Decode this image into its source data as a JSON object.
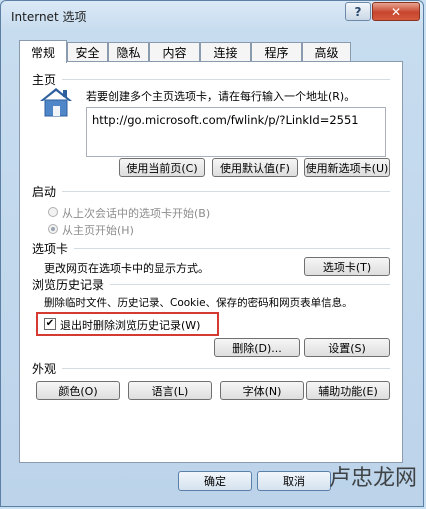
{
  "window": {
    "title": "Internet 选项",
    "help": "?",
    "close": "✕"
  },
  "tabs": [
    {
      "label": "常规",
      "active": true
    },
    {
      "label": "安全"
    },
    {
      "label": "隐私"
    },
    {
      "label": "内容"
    },
    {
      "label": "连接"
    },
    {
      "label": "程序"
    },
    {
      "label": "高级"
    }
  ],
  "home": {
    "title": "主页",
    "icon": "home-icon",
    "description": "若要创建多个主页选项卡，请在每行输入一个地址(R)。",
    "url": "http://go.microsoft.com/fwlink/p/?LinkId=2551",
    "buttons": {
      "current": "使用当前页(C)",
      "default": "使用默认值(F)",
      "new_tab": "使用新选项卡(U)"
    }
  },
  "startup": {
    "title": "启动",
    "options": [
      "从上次会话中的选项卡开始(B)",
      "从主页开始(H)"
    ],
    "selected": 1
  },
  "tabs_section": {
    "title": "选项卡",
    "description": "更改网页在选项卡中的显示方式。",
    "button": "选项卡(T)"
  },
  "history": {
    "title": "浏览历史记录",
    "description": "删除临时文件、历史记录、Cookie、保存的密码和网页表单信息。",
    "checkbox_label": "退出时删除浏览历史记录(W)",
    "checkbox_checked": true,
    "delete": "删除(D)...",
    "settings": "设置(S)"
  },
  "appearance": {
    "title": "外观",
    "buttons": [
      "颜色(O)",
      "语言(L)",
      "字体(N)",
      "辅助功能(E)"
    ]
  },
  "footer": {
    "ok": "确定",
    "cancel": "取消",
    "watermark": "卢忠龙网"
  }
}
